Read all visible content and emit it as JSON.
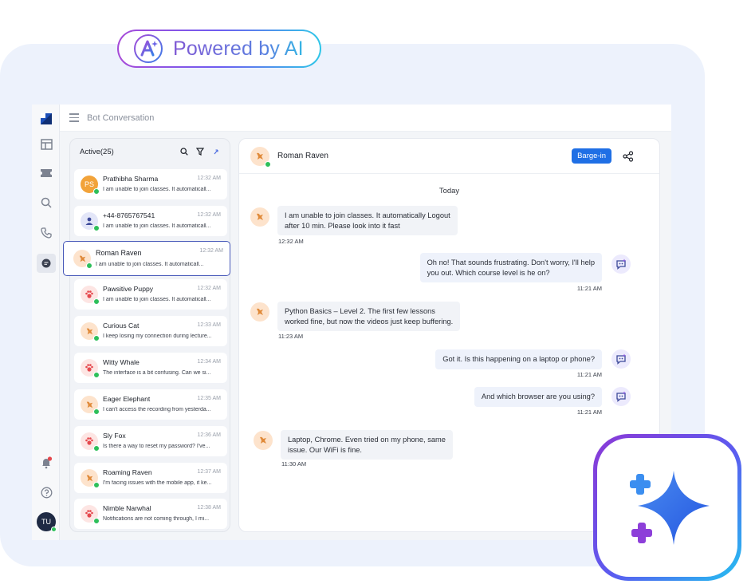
{
  "badge": {
    "text": "Powered by AI"
  },
  "topbar": {
    "title": "Bot Conversation"
  },
  "list": {
    "title": "Active(25)",
    "conversations": [
      {
        "name": "Prathibha Sharma",
        "initials": "PS",
        "time": "12:32 AM",
        "preview": "I am unable to join classes. It automaticall..."
      },
      {
        "name": "+44-8765767541",
        "initials": "",
        "time": "12:32 AM",
        "preview": "I am unable to join classes. It automaticall..."
      },
      {
        "name": "Roman Raven",
        "initials": "",
        "time": "12:32 AM",
        "preview": "I am unable to join classes. It automaticall..."
      },
      {
        "name": "Pawsitive Puppy",
        "initials": "",
        "time": "12:32 AM",
        "preview": "I am unable to join classes. It automaticall..."
      },
      {
        "name": "Curious Cat",
        "initials": "",
        "time": "12:33 AM",
        "preview": "I keep losing my connection during lecture..."
      },
      {
        "name": "Witty Whale",
        "initials": "",
        "time": "12:34 AM",
        "preview": "The interface is a bit confusing. Can we si..."
      },
      {
        "name": "Eager Elephant",
        "initials": "",
        "time": "12:35 AM",
        "preview": "I can't access the recording from yesterda..."
      },
      {
        "name": "Sly Fox",
        "initials": "",
        "time": "12:36 AM",
        "preview": "Is there a way to reset my password? I've..."
      },
      {
        "name": "Roaming Raven",
        "initials": "",
        "time": "12:37 AM",
        "preview": "I'm facing issues with the mobile app, it ke..."
      },
      {
        "name": "Nimble Narwhal",
        "initials": "",
        "time": "12:38 AM",
        "preview": "Notifications are not coming through, I mi..."
      }
    ]
  },
  "chat": {
    "contact_name": "Roman Raven",
    "barge_label": "Barge-in",
    "day_label": "Today",
    "messages": [
      {
        "side": "left",
        "text_line1": "I am unable to join classes. It automatically Logout",
        "text_line2": "after 10 min. Please look into it fast",
        "time": "12:32 AM"
      },
      {
        "side": "right",
        "text_line1": "Oh no! That sounds frustrating. Don't worry, I'll help",
        "text_line2": "you out. Which course level is he on?",
        "time": "11:21 AM"
      },
      {
        "side": "left",
        "text_line1": "Python Basics – Level 2. The first few lessons",
        "text_line2": "worked fine, but now the videos just keep buffering.",
        "time": "11:23 AM"
      },
      {
        "side": "right",
        "text_line1": "Got it. Is this happening on a laptop or phone?",
        "text_line2": "",
        "time": "11:21 AM"
      },
      {
        "side": "right",
        "text_line1": "And which browser are you using?",
        "text_line2": "",
        "time": "11:21 AM"
      },
      {
        "side": "left",
        "text_line1": "Laptop, Chrome. Even tried on my phone, same",
        "text_line2": "issue. Our WiFi is fine.",
        "time": "11:30 AM"
      }
    ]
  },
  "user": {
    "initials": "TU"
  },
  "colors": {
    "accent": "#1f6fe5",
    "selected_border": "#4657b8",
    "whatsapp": "#2ebf5a",
    "avatar_orange": "#f2a33a"
  },
  "icons": [
    "app-logo-icon",
    "table-icon",
    "ticket-icon",
    "search-icon",
    "phone-icon",
    "chat-icon",
    "bell-icon",
    "help-icon",
    "filter-icon",
    "sort-icon",
    "share-icon",
    "bot-icon",
    "sparkle-icon"
  ]
}
